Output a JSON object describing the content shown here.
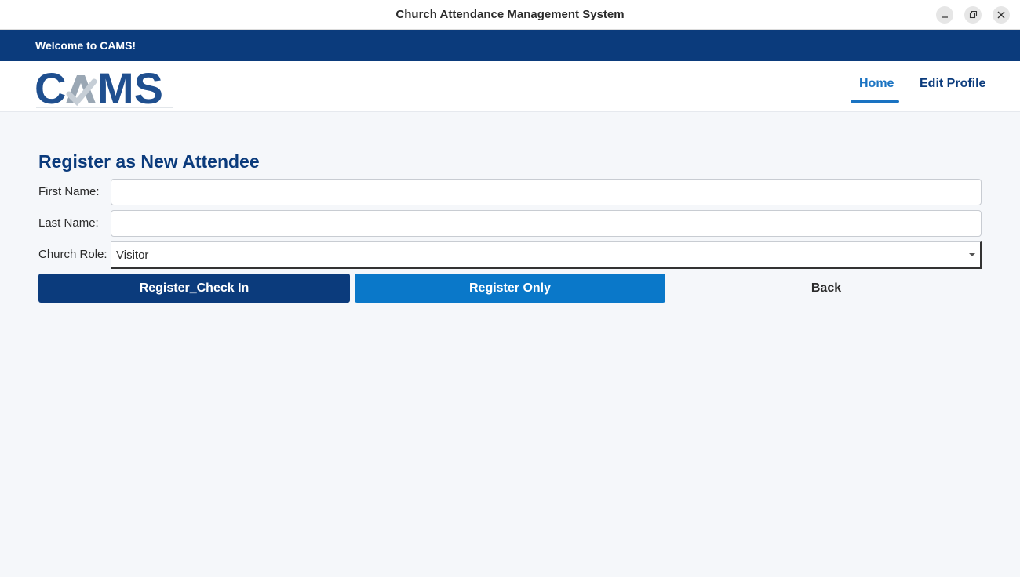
{
  "window": {
    "title": "Church Attendance Management System"
  },
  "banner": {
    "welcome": "Welcome to CAMS!"
  },
  "nav": {
    "logo_text": "CAMS",
    "home": "Home",
    "edit_profile": "Edit Profile",
    "active": "Home"
  },
  "form": {
    "heading": "Register as New Attendee",
    "first_name": {
      "label": "First Name:",
      "value": ""
    },
    "last_name": {
      "label": "Last Name:",
      "value": ""
    },
    "church_role": {
      "label": "Church Role:",
      "value": "Visitor"
    }
  },
  "buttons": {
    "register_checkin": "Register_Check In",
    "register_only": "Register Only",
    "back": "Back"
  },
  "colors": {
    "primary": "#0b3b7c",
    "accent": "#0a78c9",
    "background": "#f5f7fa"
  }
}
